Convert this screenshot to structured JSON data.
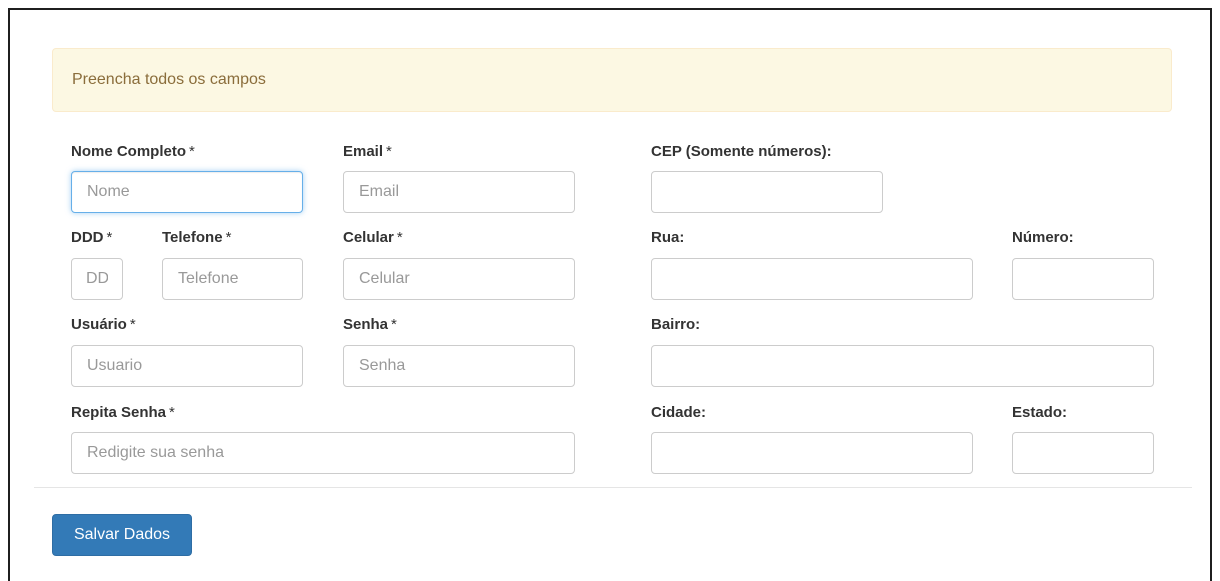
{
  "alert": {
    "message": "Preencha todos os campos"
  },
  "fields": {
    "nome": {
      "label": "Nome Completo",
      "required": "*",
      "placeholder": "Nome",
      "value": ""
    },
    "email": {
      "label": "Email",
      "required": "*",
      "placeholder": "Email",
      "value": ""
    },
    "cep": {
      "label": "CEP (Somente números):",
      "placeholder": "",
      "value": ""
    },
    "ddd": {
      "label": "DDD",
      "required": "*",
      "placeholder": "DDD",
      "value": ""
    },
    "telefone": {
      "label": "Telefone",
      "required": "*",
      "placeholder": "Telefone",
      "value": ""
    },
    "celular": {
      "label": "Celular",
      "required": "*",
      "placeholder": "Celular",
      "value": ""
    },
    "rua": {
      "label": "Rua:",
      "placeholder": "",
      "value": ""
    },
    "numero": {
      "label": "Número:",
      "placeholder": "",
      "value": ""
    },
    "usuario": {
      "label": "Usuário",
      "required": "*",
      "placeholder": "Usuario",
      "value": ""
    },
    "senha": {
      "label": "Senha",
      "required": "*",
      "placeholder": "Senha",
      "value": ""
    },
    "bairro": {
      "label": "Bairro:",
      "placeholder": "",
      "value": ""
    },
    "repita_senha": {
      "label": "Repita Senha",
      "required": "*",
      "placeholder": "Redigite sua senha",
      "value": ""
    },
    "cidade": {
      "label": "Cidade:",
      "placeholder": "",
      "value": ""
    },
    "estado": {
      "label": "Estado:",
      "placeholder": "",
      "value": ""
    }
  },
  "actions": {
    "save_label": "Salvar Dados"
  },
  "colors": {
    "primary": "#337ab7",
    "alert_bg": "#fcf8e3",
    "alert_text": "#8a6d3b",
    "focus_border": "#66afe9"
  }
}
